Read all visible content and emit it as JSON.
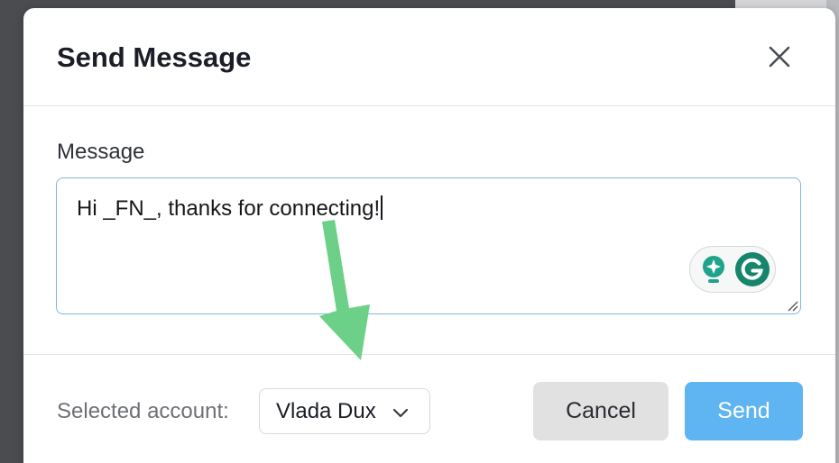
{
  "dialog": {
    "title": "Send Message",
    "close_icon": "close-icon"
  },
  "message": {
    "label": "Message",
    "value": "Hi _FN_, thanks for connecting!"
  },
  "grammarly": {
    "suggestion_icon": "lightbulb-sparkle-icon",
    "logo_icon": "grammarly-g-icon",
    "colors": {
      "bulb": "#1fa48c",
      "logo": "#15856b"
    }
  },
  "footer": {
    "account_label": "Selected account:",
    "account_value": "Vlada Dux",
    "account_chevron_icon": "chevron-down-icon",
    "cancel_label": "Cancel",
    "send_label": "Send"
  },
  "annotation": {
    "arrow_icon": "arrow-down-annotation",
    "color": "#6dd089"
  },
  "colors": {
    "send_button": "#5fb4f2",
    "cancel_button": "#e1e1e2",
    "input_border_focus": "#7fb6e3"
  }
}
